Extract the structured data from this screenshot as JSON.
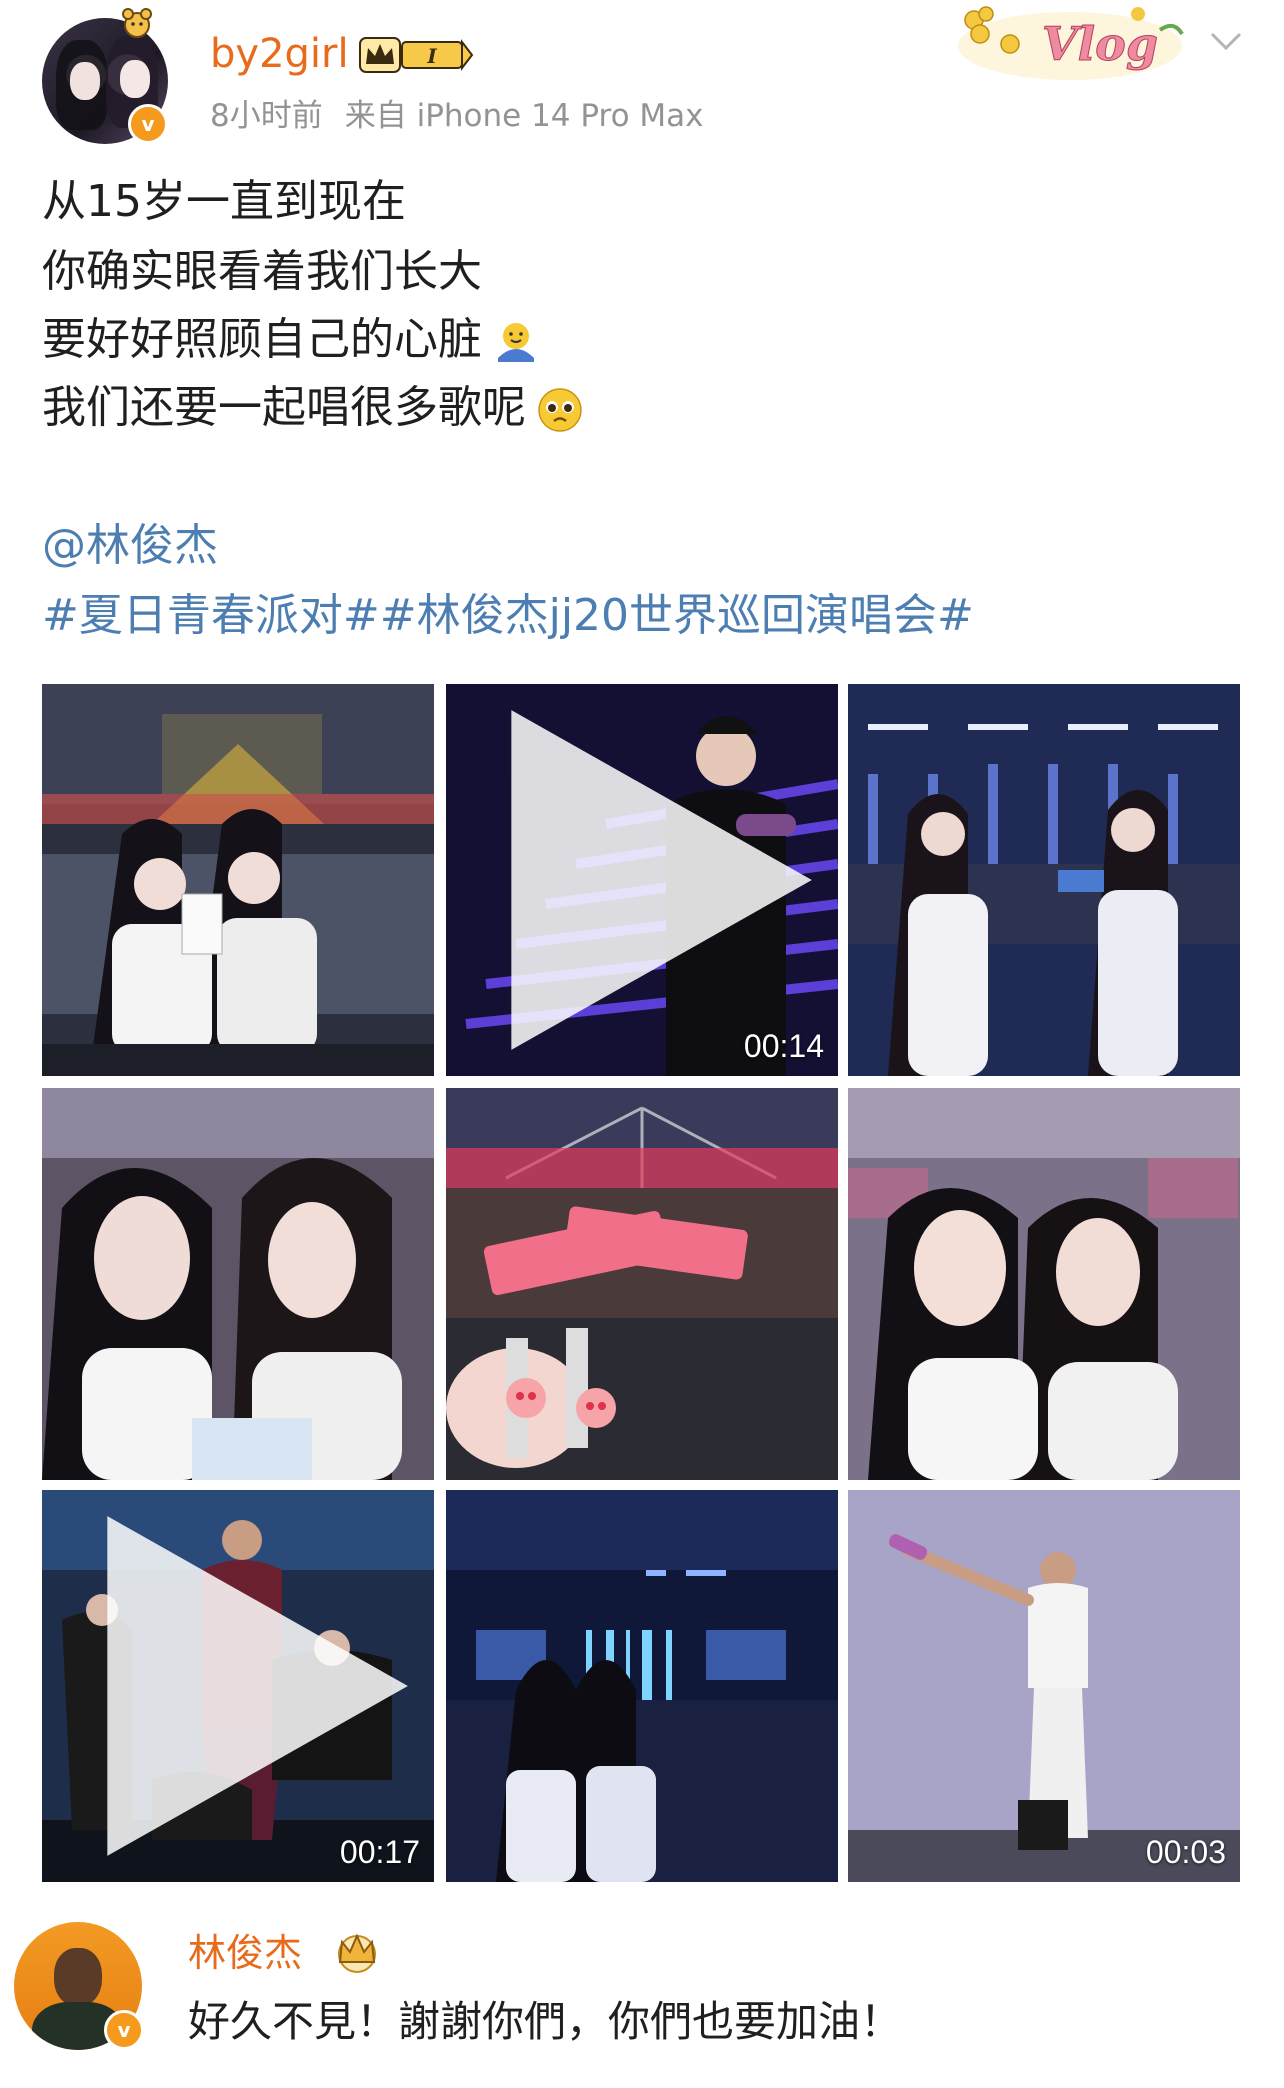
{
  "post": {
    "username": "by2girl",
    "member_badge_level": "I",
    "time_ago": "8小时前",
    "source": "来自 iPhone 14 Pro Max",
    "sticker_text": "Vlog",
    "text_lines": [
      "从15岁一直到现在",
      "你确实眼看着我们长大",
      "要好好照顾自己的心脏",
      "我们还要一起唱很多歌呢"
    ],
    "mention": "@林俊杰",
    "hashtags": "#夏日青春派对##林俊杰jj20世界巡回演唱会#",
    "media": [
      {
        "type": "photo",
        "duration": null
      },
      {
        "type": "video",
        "duration": "00:14"
      },
      {
        "type": "photo",
        "duration": null
      },
      {
        "type": "photo",
        "duration": null
      },
      {
        "type": "photo",
        "duration": null
      },
      {
        "type": "photo",
        "duration": null
      },
      {
        "type": "video",
        "duration": "00:17"
      },
      {
        "type": "photo",
        "duration": null
      },
      {
        "type": "video",
        "duration": "00:03"
      }
    ]
  },
  "comment": {
    "username": "林俊杰",
    "text": "好久不見！謝謝你們，你們也要加油！"
  },
  "colors": {
    "username": "#e86a1b",
    "link": "#4c7eb1",
    "meta": "#939393",
    "verified": "#f59a1c"
  }
}
